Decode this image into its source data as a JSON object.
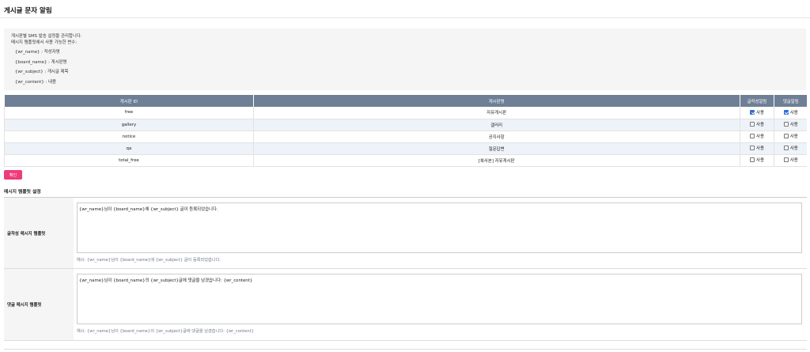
{
  "page": {
    "title": "게시글 문자 알림"
  },
  "info": {
    "line1": "게시판별 SMS 발송 설정을 관리합니다.",
    "line2": "메시지 템플릿에서 사용 가능한 변수:",
    "vars": [
      "{wr_name} : 작성자명",
      "{board_name} : 게시판명",
      "{wr_subject} : 게시글 제목",
      "{wr_content} : 내용"
    ]
  },
  "table": {
    "headers": [
      "게시판 ID",
      "게시판명",
      "글작성알림",
      "댓글알림"
    ],
    "rows": [
      {
        "id": "free",
        "name": "자유게시판",
        "post_label": "사용",
        "post_checked": true,
        "comment_label": "사용",
        "comment_checked": true
      },
      {
        "id": "gallery",
        "name": "갤러리",
        "post_label": "사용",
        "post_checked": false,
        "comment_label": "사용",
        "comment_checked": false
      },
      {
        "id": "notice",
        "name": "공지사항",
        "post_label": "사용",
        "post_checked": false,
        "comment_label": "사용",
        "comment_checked": false
      },
      {
        "id": "qa",
        "name": "질문답변",
        "post_label": "사용",
        "post_checked": false,
        "comment_label": "사용",
        "comment_checked": false
      },
      {
        "id": "total_free",
        "name": "[복사본] 자유게시판",
        "post_label": "사용",
        "post_checked": false,
        "comment_label": "사용",
        "comment_checked": false
      }
    ]
  },
  "confirm_button": "확인",
  "templates": {
    "section_title": "메시지 템플릿 설정",
    "post": {
      "label": "글작성 메시지 템플릿",
      "value": "{wr_name}님이 {board_name}에 {wr_subject} 글이 등록되었습니다.",
      "example": "예시: {wr_name}님이 {board_name}에 {wr_subject} 글이 등록되었습니다."
    },
    "comment": {
      "label": "댓글 메시지 템플릿",
      "value": "{wr_name}님이 {board_name}의 {wr_subject}글에 댓글을 남겼습니다: {wr_content}",
      "example": "예시: {wr_name}님이 {board_name}의 {wr_subject}글에 댓글을 남겼습니다: {wr_content}"
    }
  },
  "colors": {
    "table_header": "#6e7f96",
    "accent_button": "#ee3b7b",
    "row_alt": "#eef2f9",
    "checkbox_checked": "#2d6fd6"
  }
}
